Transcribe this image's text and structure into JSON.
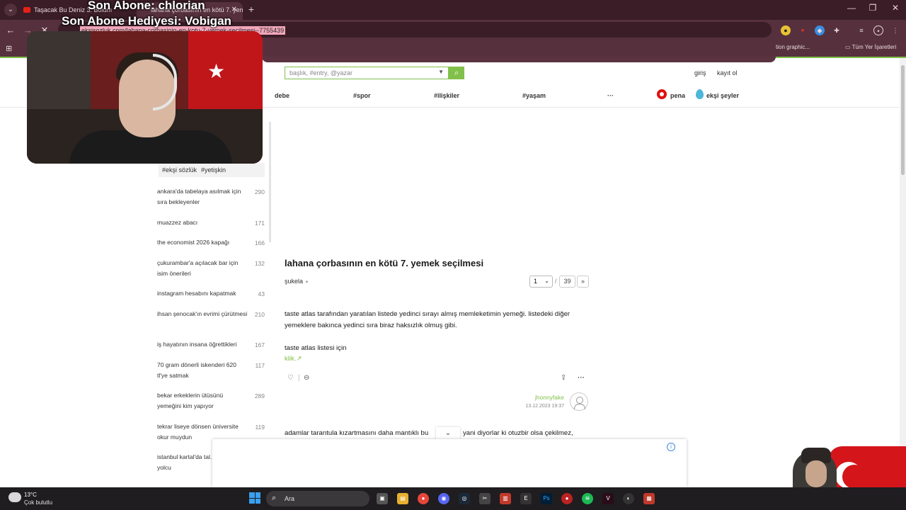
{
  "browser": {
    "tabs": [
      {
        "label": "Taşacak Bu Deniz 3. Bölüm"
      },
      {
        "label": "lahana çorbasının en kötü 7. yemek"
      }
    ],
    "url": "eksisozluk.com/lahana-corbasinin-en-kotu-7-yemek-secilmesi--7755439",
    "bookmarks": [
      {
        "label": "tion graphic..."
      },
      {
        "label": "Tüm Yer İşaretleri"
      }
    ]
  },
  "overlay": {
    "line1": "Son Abone: chlorian",
    "line2": "Son Abone Hediyesi: Vobigan"
  },
  "site": {
    "search_placeholder": "başlık, #entry, @yazar",
    "login": "giriş",
    "register": "kayıt ol",
    "nav": [
      "debe",
      "#spor",
      "#ilişkiler",
      "#yaşam",
      "···"
    ],
    "pena": "pena",
    "eksi_seyler": "ekşi şeyler"
  },
  "sidebar": {
    "tags": [
      "#ekşi sözlük",
      "#yetişkin"
    ],
    "items": [
      {
        "title": "ankara'da tabelaya asılmak için sıra bekleyenler",
        "count": "290"
      },
      {
        "title": "muazzez abacı",
        "count": "171"
      },
      {
        "title": "the economist 2026 kapağı",
        "count": "166"
      },
      {
        "title": "çukurambar'a açılacak bar için isim önerileri",
        "count": "132"
      },
      {
        "title": "instagram hesabını kapatmak",
        "count": "43"
      },
      {
        "title": "ihsan şenocak'ın evrimi çürütmesi",
        "count": "210"
      },
      {
        "title": "iş hayatının insana öğrettikleri",
        "count": "167"
      },
      {
        "title": "70 gram dönerli iskenderi 620 tl'ye satmak",
        "count": "117"
      },
      {
        "title": "bekar erkeklerin ütüsünü yemeğini kim yapıyor",
        "count": "289"
      },
      {
        "title": "tekrar liseye dönsen üniversite okur muydun",
        "count": "119"
      },
      {
        "title": "istanbul kartal'da tal... eden kadın yolcu",
        "count": ""
      }
    ]
  },
  "topic": {
    "title": "lahana çorbasının en kötü 7. yemek seçilmesi",
    "sort": "şukela",
    "page_current": "1",
    "page_total": "39",
    "next": "»"
  },
  "entry": {
    "para1": "taste atlas tarafından yaratılan listede yedinci sırayı almış memleketimin yemeği. listedeki diğer yemeklere bakınca yedinci sıra biraz haksızlık olmuş gibi.",
    "para2": "taste atlas listesi için",
    "link": "klik.",
    "author": "jhonnyfake",
    "date": "13.12.2023 19:37"
  },
  "entry2": {
    "preview_left": "adamlar tarantula kızartmasını daha mantıklı bu",
    "preview_right": "yani diyorlar ki otuzbir olsa çekilmez,"
  },
  "taskbar": {
    "temp": "13°C",
    "weather": "Çok bulutlu",
    "search": "Ara"
  }
}
